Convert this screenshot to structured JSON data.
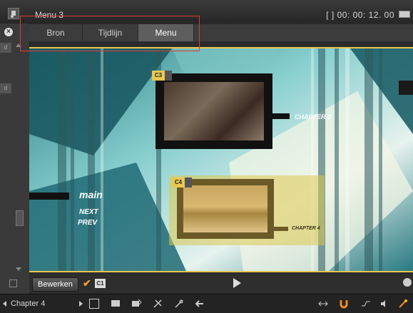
{
  "window": {
    "title": "Menu 3",
    "timecode": "[ ] 00: 00: 12. 00"
  },
  "tabs": [
    {
      "label": "Bron",
      "active": false
    },
    {
      "label": "Tijdlijn",
      "active": false
    },
    {
      "label": "Menu",
      "active": true
    }
  ],
  "menu_preview": {
    "main_label": "main",
    "next_label": "NEXT",
    "prev_label": "PREV",
    "chapters": [
      {
        "tag": "C3",
        "caption": "CHAPTER 3"
      },
      {
        "tag": "C4",
        "caption": "CHAPTER 4"
      }
    ]
  },
  "controls": {
    "edit_button": "Bewerken",
    "chapter_badge": "C1"
  },
  "bottombar": {
    "chapter": "Chapter 4"
  },
  "colors": {
    "accent": "#e8c850",
    "highlight": "#e03a3a",
    "tab_active": "#5e5e5e"
  }
}
